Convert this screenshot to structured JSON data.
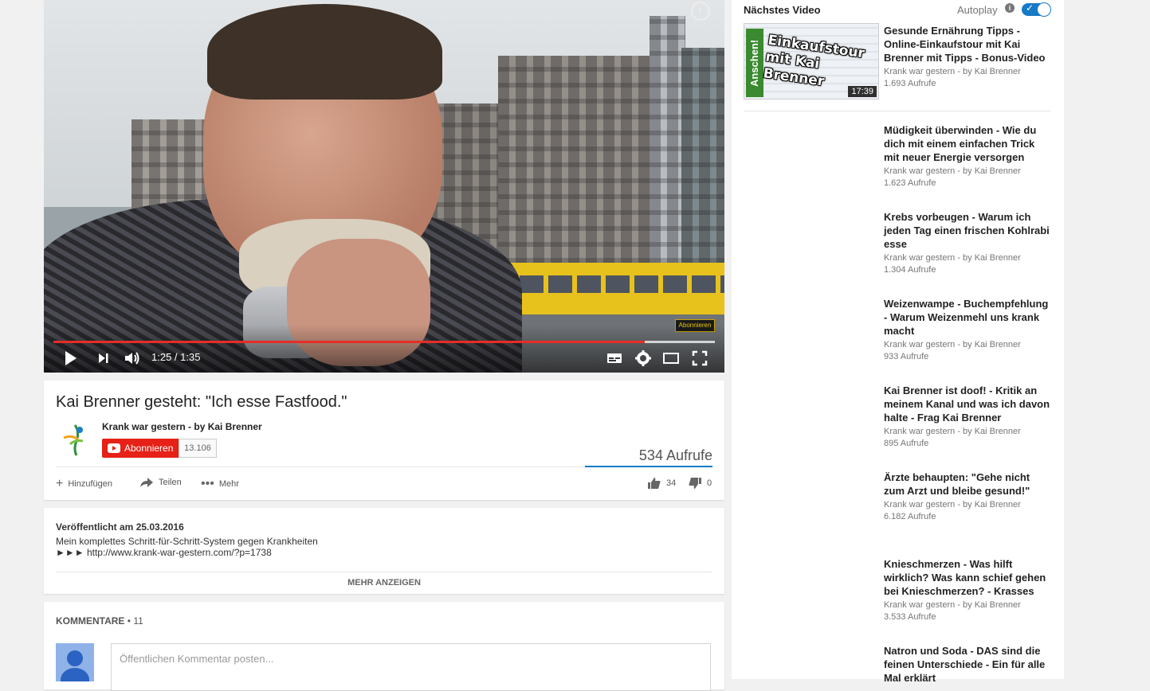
{
  "player": {
    "time": "1:25 / 1:35",
    "played_fraction": 0.894,
    "buffered_fraction": 1.0,
    "end_screen_badge": "Abonnieren"
  },
  "video": {
    "title": "Kai Brenner gesteht: \"Ich esse Fastfood.\"",
    "channel": "Krank war gestern - by Kai Brenner",
    "subscribe_label": "Abonnieren",
    "subscriber_count": "13.106",
    "views": "534 Aufrufe",
    "actions": {
      "add": "Hinzufügen",
      "share": "Teilen",
      "more": "Mehr"
    },
    "likes": "34",
    "dislikes": "0"
  },
  "description": {
    "published": "Veröffentlicht am 25.03.2016",
    "line1": "Mein komplettes Schritt-für-Schritt-System gegen Krankheiten",
    "line2": "►►► http://www.krank-war-gestern.com/?p=1738",
    "show_more": "MEHR ANZEIGEN"
  },
  "comments": {
    "header": "KOMMENTARE",
    "count": "• 11",
    "placeholder": "Öffentlichen Kommentar posten..."
  },
  "sidebar": {
    "next_label": "Nächstes Video",
    "autoplay_label": "Autoplay",
    "next_video": {
      "title": "Gesunde Ernährung Tipps - Online-Einkaufstour mit Kai Brenner mit Tipps - Bonus-Video",
      "channel": "Krank war gestern - by Kai Brenner",
      "views": "1.693 Aufrufe",
      "duration": "17:39",
      "thumb_side_text": "Anschen!",
      "thumb_text": "Einkaufstour mit Kai Brenner"
    },
    "related": [
      {
        "title": "Müdigkeit überwinden - Wie du dich mit einem einfachen Trick mit neuer Energie versorgen",
        "channel": "Krank war gestern - by Kai Brenner",
        "views": "1.623 Aufrufe"
      },
      {
        "title": "Krebs vorbeugen - Warum ich jeden Tag einen frischen Kohlrabi esse",
        "channel": "Krank war gestern - by Kai Brenner",
        "views": "1.304 Aufrufe"
      },
      {
        "title": "Weizenwampe - Buchempfehlung - Warum Weizenmehl uns krank macht",
        "channel": "Krank war gestern - by Kai Brenner",
        "views": "933 Aufrufe"
      },
      {
        "title": "Kai Brenner ist doof! - Kritik an meinem Kanal und was ich davon halte - Frag Kai Brenner",
        "channel": "Krank war gestern - by Kai Brenner",
        "views": "895 Aufrufe"
      },
      {
        "title": "Ärzte behaupten: \"Gehe nicht zum Arzt und bleibe gesund!\"",
        "channel": "Krank war gestern - by Kai Brenner",
        "views": "6.182 Aufrufe"
      },
      {
        "title": "Knieschmerzen - Was hilft wirklich? Was kann schief gehen bei Knieschmerzen? - Krasses",
        "channel": "Krank war gestern - by Kai Brenner",
        "views": "3.533 Aufrufe"
      },
      {
        "title": "Natron und Soda - DAS sind die feinen Unterschiede - Ein für alle Mal erklärt",
        "channel": "",
        "views": ""
      }
    ]
  },
  "colors": {
    "accent": "#167ac6",
    "subscribe": "#e62117",
    "progress": "#e52d27"
  }
}
